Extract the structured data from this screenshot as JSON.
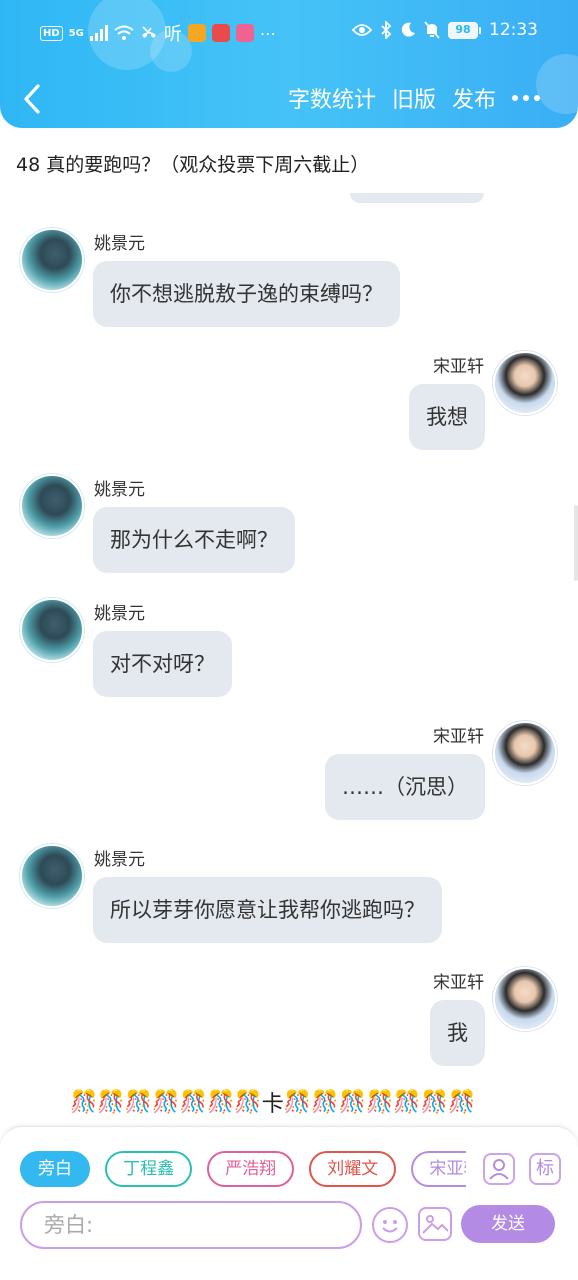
{
  "status_bar": {
    "left_items": [
      "HD",
      "5G"
    ],
    "time": "12:33",
    "battery": "98"
  },
  "nav": {
    "word_count": "字数统计",
    "old_version": "旧版",
    "publish": "发布"
  },
  "topic": "48 真的要跑吗？（观众投票下周六截止）",
  "messages": [
    {
      "sender": "姚景元",
      "side": "left",
      "text": "你不想逃脱敖子逸的束缚吗？"
    },
    {
      "sender": "宋亚轩",
      "side": "right",
      "text": "我想"
    },
    {
      "sender": "姚景元",
      "side": "left",
      "text": "那为什么不走啊？"
    },
    {
      "sender": "姚景元",
      "side": "left",
      "text": "对不对呀？"
    },
    {
      "sender": "宋亚轩",
      "side": "right",
      "text": "……（沉思）"
    },
    {
      "sender": "姚景元",
      "side": "left",
      "text": "所以芽芽你愿意让我帮你逃跑吗？"
    },
    {
      "sender": "宋亚轩",
      "side": "right",
      "text": "我"
    }
  ],
  "narration": {
    "emoji_left": "🎊🎊🎊🎊🎊🎊🎊",
    "text": "卡",
    "emoji_right": "🎊🎊🎊🎊🎊🎊🎊"
  },
  "characters": [
    {
      "label": "旁白",
      "color": "#34b8f0",
      "active": true
    },
    {
      "label": "丁程鑫",
      "color": "#2bbfb0",
      "active": false
    },
    {
      "label": "严浩翔",
      "color": "#e0609a",
      "active": false
    },
    {
      "label": "刘耀文",
      "color": "#e0554c",
      "active": false
    },
    {
      "label": "宋亚轩",
      "color": "#b58bdf",
      "active": false
    }
  ],
  "tools": {
    "mark_label": "标"
  },
  "input": {
    "placeholder": "旁白:"
  },
  "send_label": "发送"
}
